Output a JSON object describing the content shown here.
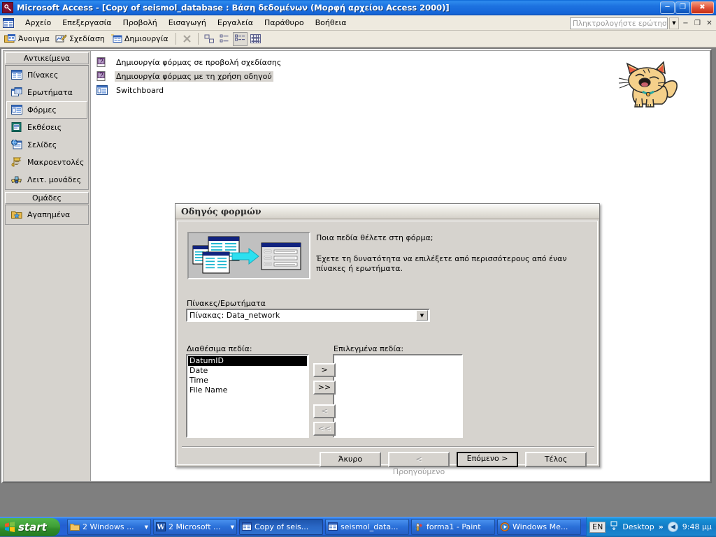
{
  "window": {
    "title": "Microsoft Access - [Copy of seismol_database : Βάση δεδομένων (Μορφή αρχείου Access 2000)]",
    "app_icon": "access-key-icon",
    "minimize": "minimize-icon",
    "restore": "restore-icon",
    "close": "close-icon"
  },
  "menubar": {
    "items": [
      {
        "label": "Αρχείο"
      },
      {
        "label": "Επεξεργασία"
      },
      {
        "label": "Προβολή"
      },
      {
        "label": "Εισαγωγή"
      },
      {
        "label": "Εργαλεία"
      },
      {
        "label": "Παράθυρο"
      },
      {
        "label": "Βοήθεια"
      }
    ],
    "ask_placeholder": "Πληκτρολογήστε ερώτηση",
    "ask_value": "",
    "mdi_minimize": "−",
    "mdi_restore": "❐",
    "mdi_close": "✕"
  },
  "toolbar": {
    "open_label": "Άνοιγμα",
    "design_label": "Σχεδίαση",
    "new_label": "Δημιουργία",
    "delete_label": "✕",
    "view_large_icons": "large-icons-view",
    "view_small_icons": "small-icons-view",
    "view_list": "list-view",
    "view_details": "details-view"
  },
  "db_window": {
    "objects_header": "Αντικείμενα",
    "groups_header": "Ομάδες",
    "objects": [
      {
        "label": "Πίνακες",
        "icon": "table-icon",
        "selected": false
      },
      {
        "label": "Ερωτήματα",
        "icon": "query-icon",
        "selected": false
      },
      {
        "label": "Φόρμες",
        "icon": "form-icon",
        "selected": true
      },
      {
        "label": "Εκθέσεις",
        "icon": "report-icon",
        "selected": false
      },
      {
        "label": "Σελίδες",
        "icon": "page-icon",
        "selected": false
      },
      {
        "label": "Μακροεντολές",
        "icon": "macro-icon",
        "selected": false
      },
      {
        "label": "Λειτ. μονάδες",
        "icon": "module-icon",
        "selected": false
      }
    ],
    "groups": [
      {
        "label": "Αγαπημένα",
        "icon": "favorites-icon"
      }
    ],
    "form_rows": [
      {
        "label": "Δημιουργία φόρμας σε προβολή σχεδίασης",
        "icon": "new-form-icon",
        "highlighted": false
      },
      {
        "label": "Δημιουργία φόρμας με τη χρήση οδηγού",
        "icon": "new-form-icon",
        "highlighted": true
      },
      {
        "label": "Switchboard",
        "icon": "form-icon",
        "highlighted": false
      }
    ],
    "clipart": "cat-clipart"
  },
  "wizard": {
    "title": "Οδηγός φορμών",
    "illustration": "tables-to-form-illustration",
    "question": "Ποια πεδία θέλετε στη φόρμα;",
    "hint": "Έχετε τη δυνατότητα να επιλέξετε από περισσότερους από έναν πίνακες ή ερωτήματα.",
    "tables_label": "Πίνακες/Ερωτήματα",
    "tables_value": "Πίνακας: Data_network",
    "tables_arrow": "chevron-down-icon",
    "available_label": "Διαθέσιμα πεδία:",
    "selected_label": "Επιλεγμένα πεδία:",
    "available_fields": [
      "DatumID",
      "Date",
      "Time",
      "File Name"
    ],
    "available_selected_index": 0,
    "selected_fields": [],
    "move_buttons": [
      {
        "name": "move-one-right",
        "label": ">",
        "disabled": false
      },
      {
        "name": "move-all-right",
        "label": ">>",
        "disabled": false
      },
      {
        "name": "move-one-left",
        "label": "<",
        "disabled": true
      },
      {
        "name": "move-all-left",
        "label": "<<",
        "disabled": true
      }
    ],
    "buttons": {
      "cancel": "Άκυρο",
      "back": "< Προηγούμενο",
      "next": "Επόμενο >",
      "finish": "Τέλος"
    }
  },
  "taskbar": {
    "start_label": "start",
    "items": [
      {
        "label": "2 Windows ...",
        "icon": "folder-icon",
        "active": false,
        "has_arrow": true
      },
      {
        "label": "2 Microsoft ...",
        "icon": "word-icon",
        "active": false,
        "has_arrow": true
      },
      {
        "label": "Copy of seis...",
        "icon": "access-icon",
        "active": true,
        "has_arrow": false
      },
      {
        "label": "seismol_data...",
        "icon": "access-icon",
        "active": false,
        "has_arrow": false
      },
      {
        "label": "forma1 - Paint",
        "icon": "paint-icon",
        "active": false,
        "has_arrow": false
      },
      {
        "label": "Windows Me...",
        "icon": "media-player-icon",
        "active": false,
        "has_arrow": false
      }
    ],
    "tray": {
      "language": "EN",
      "show_desktop_icon": "show-desktop-icon",
      "desktop_label": "Desktop",
      "chevron": "»",
      "collapse_icon": "collapse-tray-icon",
      "clock": "9:48 μμ"
    }
  },
  "colors": {
    "title_blue": "#1565d8",
    "face": "#d6d3ce",
    "workspace": "#7f7f7f",
    "taskbar": "#2364d8",
    "start_green": "#3f9f37",
    "selection": "#000000"
  }
}
